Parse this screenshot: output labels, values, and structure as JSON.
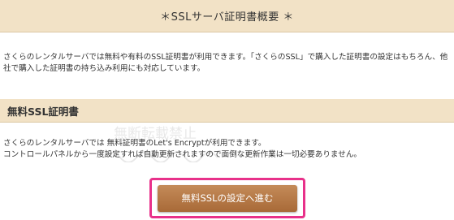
{
  "header": {
    "title": "＊SSLサーバ証明書概要 ＊"
  },
  "intro": {
    "text": "さくらのレンタルサーバでは無料や有料のSSL証明書が利用できます。「さくらのSSL」で購入した証明書の設定はもちろん、他社で購入した証明書の持ち込み利用にも対応しています。"
  },
  "free_ssl": {
    "section_title": "無料SSL証明書",
    "line1": "さくらのレンタルサーバでは 無料証明書のLet's Encryptが利用できます。",
    "line2": "コントロールパネルから一度設定すれば自動更新されますので面倒な更新作業は一切必要ありません。",
    "button_label": "無料SSLの設定へ進む"
  },
  "watermark": {
    "text_top": "無断転載禁止"
  },
  "colors": {
    "band_bg": "#f2e2c6",
    "button_bg": "#b47846",
    "highlight_border": "#e8318a",
    "text": "#333333"
  }
}
